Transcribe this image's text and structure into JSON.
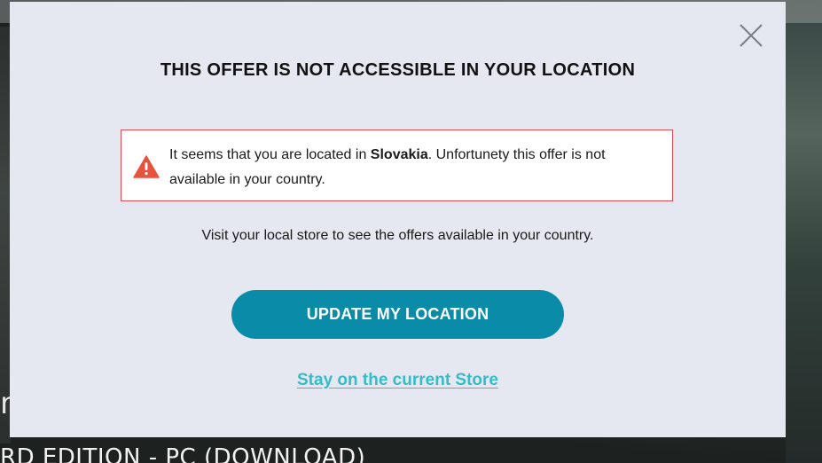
{
  "background": {
    "product_title_fragment": "RD EDITION - PC (DOWNLOAD)",
    "side_glyph": "m"
  },
  "modal": {
    "title": "THIS OFFER IS NOT ACCESSIBLE IN YOUR LOCATION",
    "close_icon": "close-x-icon",
    "alert": {
      "icon": "warning-triangle-icon",
      "text_before": "It seems that you are located in ",
      "country": "Slovakia",
      "text_after": ". Unfortunety this offer is not available in your country."
    },
    "subtext": "Visit your local store to see the offers available in your country.",
    "update_button_label": "UPDATE MY LOCATION",
    "stay_link_label": "Stay on the current Store"
  },
  "colors": {
    "modal_bg": "#e6e8f1",
    "alert_border": "#dc4b50",
    "warning_icon": "#e8533f",
    "primary_button": "#0a8ba7",
    "link": "#35bcc7"
  }
}
